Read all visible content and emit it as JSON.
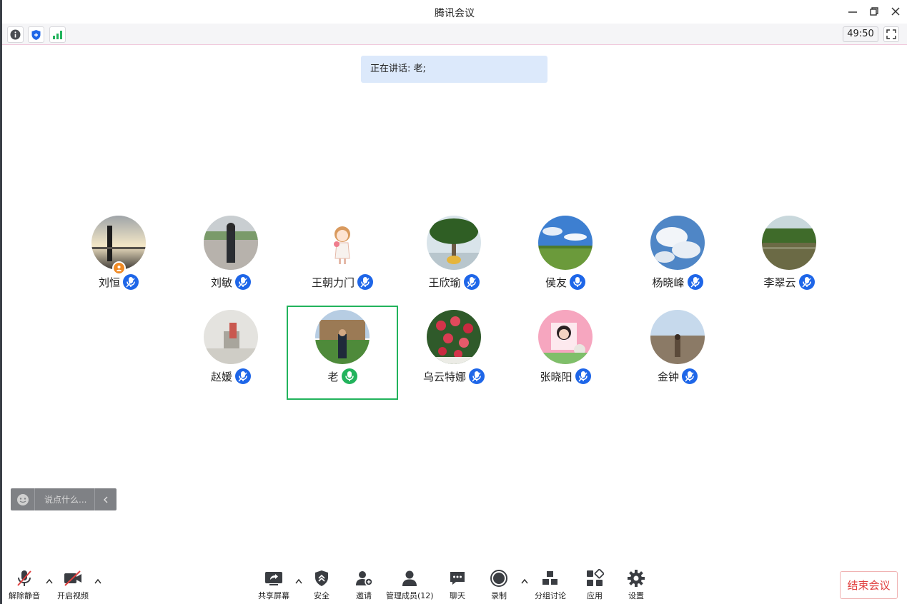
{
  "window": {
    "title": "腾讯会议",
    "timer": "49:50"
  },
  "speaking": {
    "label": "正在讲话: 老;"
  },
  "participants_row1": [
    {
      "name": "刘恒",
      "mic_color": "#1e66e8",
      "host": true
    },
    {
      "name": "刘敏",
      "mic_color": "#1e66e8"
    },
    {
      "name": "王朝力门",
      "mic_color": "#1e66e8"
    },
    {
      "name": "王欣瑜",
      "mic_color": "#1e66e8"
    },
    {
      "name": "侯友",
      "mic_color": "#1e66e8"
    },
    {
      "name": "杨晓峰",
      "mic_color": "#1e66e8"
    },
    {
      "name": "李翠云",
      "mic_color": "#1e66e8"
    }
  ],
  "participants_row2": [
    {
      "name": "赵媛",
      "mic_color": "#1e66e8"
    },
    {
      "name": "老",
      "mic_color": "#22b35c",
      "speaking": true
    },
    {
      "name": "乌云特娜",
      "mic_color": "#1e66e8"
    },
    {
      "name": "张晓阳",
      "mic_color": "#1e66e8"
    },
    {
      "name": "金钟",
      "mic_color": "#1e66e8"
    }
  ],
  "chat": {
    "placeholder": "说点什么..."
  },
  "bottom": {
    "unmute": "解除静音",
    "video": "开启视频",
    "share": "共享屏幕",
    "security": "安全",
    "invite": "邀请",
    "members": "管理成员(12)",
    "chat": "聊天",
    "record": "录制",
    "breakout": "分组讨论",
    "apps": "应用",
    "settings": "设置",
    "end": "结束会议"
  },
  "colors": {
    "accent": "#1e66e8",
    "speaking": "#22b35c",
    "end": "#e0403f"
  },
  "icons": [
    "info-icon",
    "shield-icon",
    "signal-icon",
    "minimize-icon",
    "restore-icon",
    "close-icon",
    "fullscreen-icon",
    "microphone-muted-icon",
    "video-off-icon",
    "share-screen-icon",
    "security-icon",
    "invite-icon",
    "members-icon",
    "chat-icon",
    "record-icon",
    "breakout-icon",
    "apps-icon",
    "settings-icon",
    "smile-icon",
    "collapse-icon"
  ]
}
